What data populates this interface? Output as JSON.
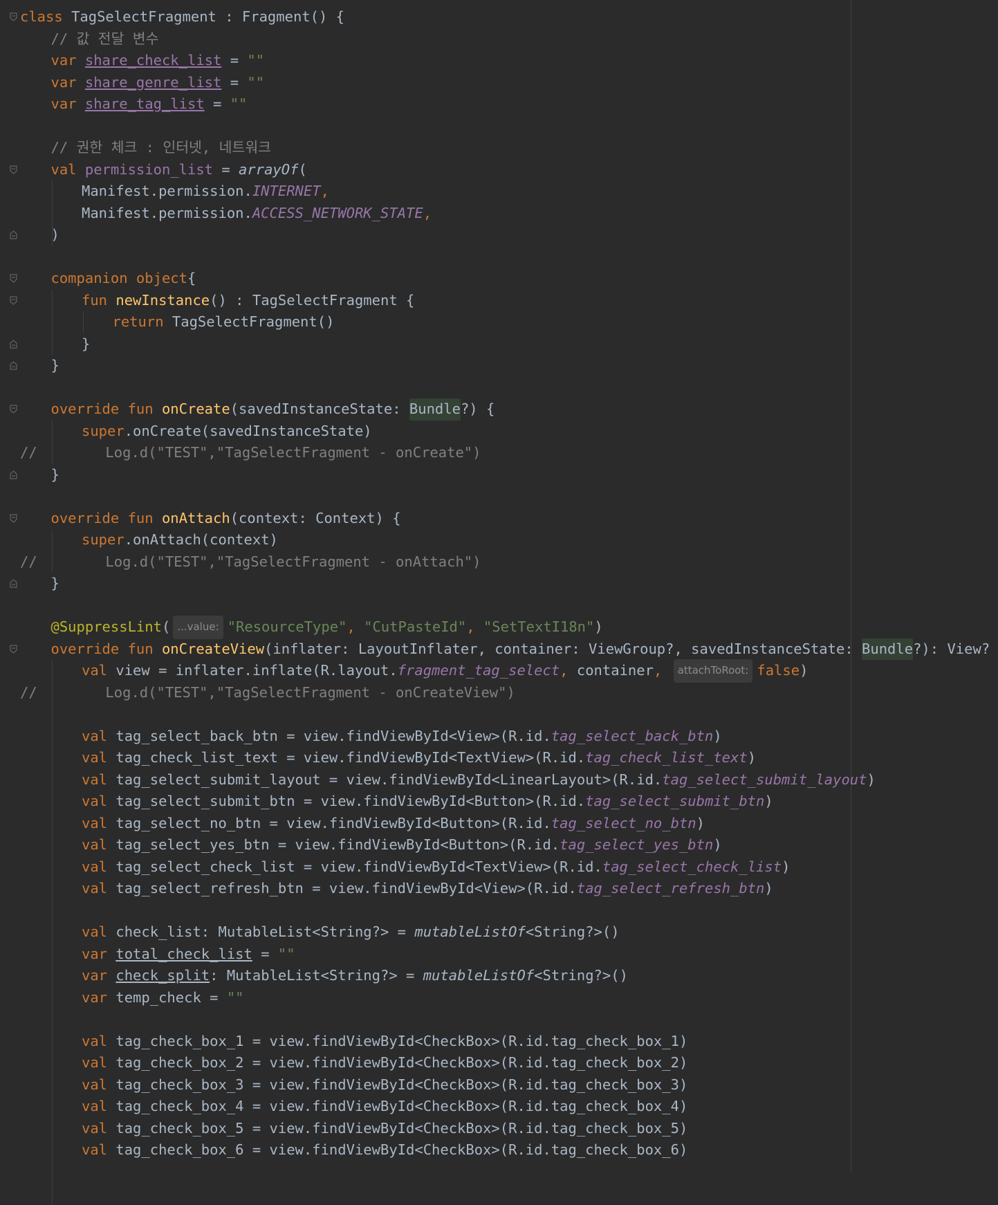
{
  "editor": {
    "language": "Kotlin",
    "theme_colors": {
      "background": "#2b2b2b",
      "keyword": "#cc7832",
      "comment": "#808080",
      "string": "#6a8759",
      "function": "#ffc66d",
      "property": "#9876aa",
      "default": "#a9b7c6",
      "annotation": "#bbb529"
    },
    "lines": [
      {
        "indent": 0,
        "fold": "open",
        "tokens": [
          [
            "kw",
            "class "
          ],
          [
            "",
            "TagSelectFragment : Fragment() {"
          ]
        ]
      },
      {
        "indent": 1,
        "tokens": [
          [
            "cm",
            "// 값 전달 변수"
          ]
        ]
      },
      {
        "indent": 1,
        "tokens": [
          [
            "kw",
            "var "
          ],
          [
            "prop ul",
            "share_check_list"
          ],
          [
            "",
            " = "
          ],
          [
            "str",
            "\"\""
          ]
        ]
      },
      {
        "indent": 1,
        "tokens": [
          [
            "kw",
            "var "
          ],
          [
            "prop ul",
            "share_genre_list"
          ],
          [
            "",
            " = "
          ],
          [
            "str",
            "\"\""
          ]
        ]
      },
      {
        "indent": 1,
        "tokens": [
          [
            "kw",
            "var "
          ],
          [
            "prop ul",
            "share_tag_list"
          ],
          [
            "",
            " = "
          ],
          [
            "str",
            "\"\""
          ]
        ]
      },
      {
        "indent": 0,
        "tokens": []
      },
      {
        "indent": 1,
        "tokens": [
          [
            "cm",
            "// 권한 체크 : 인터넷, 네트워크"
          ]
        ]
      },
      {
        "indent": 1,
        "fold": "open",
        "tokens": [
          [
            "kw",
            "val "
          ],
          [
            "prop",
            "permission_list"
          ],
          [
            "",
            " = "
          ],
          [
            "ital",
            "arrayOf"
          ],
          [
            "",
            "("
          ]
        ]
      },
      {
        "indent": 2,
        "tokens": [
          [
            "",
            "Manifest.permission."
          ],
          [
            "prop ital",
            "INTERNET"
          ],
          [
            "kw",
            ","
          ]
        ]
      },
      {
        "indent": 2,
        "tokens": [
          [
            "",
            "Manifest.permission."
          ],
          [
            "prop ital",
            "ACCESS_NETWORK_STATE"
          ],
          [
            "kw",
            ","
          ]
        ]
      },
      {
        "indent": 1,
        "fold": "close",
        "tokens": [
          [
            "",
            ")"
          ]
        ]
      },
      {
        "indent": 0,
        "tokens": []
      },
      {
        "indent": 1,
        "fold": "open",
        "tokens": [
          [
            "kw",
            "companion object"
          ],
          [
            "",
            "{"
          ]
        ]
      },
      {
        "indent": 2,
        "fold": "open",
        "tokens": [
          [
            "kw",
            "fun "
          ],
          [
            "fn",
            "newInstance"
          ],
          [
            "",
            "() : TagSelectFragment {"
          ]
        ]
      },
      {
        "indent": 3,
        "tokens": [
          [
            "kw",
            "return "
          ],
          [
            "",
            "TagSelectFragment()"
          ]
        ]
      },
      {
        "indent": 2,
        "fold": "close",
        "tokens": [
          [
            "",
            "}"
          ]
        ]
      },
      {
        "indent": 1,
        "fold": "close",
        "tokens": [
          [
            "",
            "}"
          ]
        ]
      },
      {
        "indent": 0,
        "tokens": []
      },
      {
        "indent": 1,
        "fold": "open",
        "tokens": [
          [
            "kw",
            "override fun "
          ],
          [
            "fn",
            "onCreate"
          ],
          [
            "",
            "(savedInstanceState: "
          ],
          [
            "hl",
            "Bundle"
          ],
          [
            "",
            "?) {"
          ]
        ]
      },
      {
        "indent": 2,
        "tokens": [
          [
            "kw",
            "super"
          ],
          [
            "",
            ".onCreate(savedInstanceState)"
          ]
        ]
      },
      {
        "indent": 0,
        "linecomment": true,
        "tokens": [
          [
            "cm",
            "//        Log.d(\"TEST\",\"TagSelectFragment - onCreate\")"
          ]
        ]
      },
      {
        "indent": 1,
        "fold": "close",
        "tokens": [
          [
            "",
            "}"
          ]
        ]
      },
      {
        "indent": 0,
        "tokens": []
      },
      {
        "indent": 1,
        "fold": "open",
        "tokens": [
          [
            "kw",
            "override fun "
          ],
          [
            "fn",
            "onAttach"
          ],
          [
            "",
            "(context: Context) {"
          ]
        ]
      },
      {
        "indent": 2,
        "tokens": [
          [
            "kw",
            "super"
          ],
          [
            "",
            ".onAttach(context)"
          ]
        ]
      },
      {
        "indent": 0,
        "linecomment": true,
        "tokens": [
          [
            "cm",
            "//        Log.d(\"TEST\",\"TagSelectFragment - onAttach\")"
          ]
        ]
      },
      {
        "indent": 1,
        "fold": "close",
        "tokens": [
          [
            "",
            "}"
          ]
        ]
      },
      {
        "indent": 0,
        "tokens": []
      },
      {
        "indent": 1,
        "tokens": [
          [
            "ann",
            "@SuppressLint"
          ],
          [
            "",
            "("
          ],
          [
            "hint",
            "...value:"
          ],
          [
            "str",
            "\"ResourceType\""
          ],
          [
            "kw",
            ", "
          ],
          [
            "str",
            "\"CutPasteId\""
          ],
          [
            "kw",
            ", "
          ],
          [
            "str",
            "\"SetTextI18n\""
          ],
          [
            "",
            ")"
          ]
        ]
      },
      {
        "indent": 1,
        "fold": "open",
        "tokens": [
          [
            "kw",
            "override fun "
          ],
          [
            "fn",
            "onCreateView"
          ],
          [
            "",
            "(inflater: LayoutInflater, container: ViewGroup?, savedInstanceState: "
          ],
          [
            "hl",
            "Bundle"
          ],
          [
            "",
            "?): View? {"
          ]
        ]
      },
      {
        "indent": 2,
        "tokens": [
          [
            "kw",
            "val "
          ],
          [
            "",
            "view = inflater.inflate(R.layout."
          ],
          [
            "prop ital",
            "fragment_tag_select"
          ],
          [
            "kw",
            ", "
          ],
          [
            "",
            "container"
          ],
          [
            "kw",
            ", "
          ],
          [
            "hint",
            "attachToRoot:"
          ],
          [
            "kw",
            "false"
          ],
          [
            "",
            ")"
          ]
        ]
      },
      {
        "indent": 0,
        "linecomment": true,
        "tokens": [
          [
            "cm",
            "//        Log.d(\"TEST\",\"TagSelectFragment - onCreateView\")"
          ]
        ]
      },
      {
        "indent": 0,
        "tokens": []
      },
      {
        "indent": 2,
        "tokens": [
          [
            "kw",
            "val "
          ],
          [
            "",
            "tag_select_back_btn = view.findViewById<View>(R.id."
          ],
          [
            "prop ital",
            "tag_select_back_btn"
          ],
          [
            "",
            ")"
          ]
        ]
      },
      {
        "indent": 2,
        "tokens": [
          [
            "kw",
            "val "
          ],
          [
            "",
            "tag_check_list_text = view.findViewById<TextView>(R.id."
          ],
          [
            "prop ital",
            "tag_check_list_text"
          ],
          [
            "",
            ")"
          ]
        ]
      },
      {
        "indent": 2,
        "tokens": [
          [
            "kw",
            "val "
          ],
          [
            "",
            "tag_select_submit_layout = view.findViewById<LinearLayout>(R.id."
          ],
          [
            "prop ital",
            "tag_select_submit_layout"
          ],
          [
            "",
            ")"
          ]
        ]
      },
      {
        "indent": 2,
        "tokens": [
          [
            "kw",
            "val "
          ],
          [
            "",
            "tag_select_submit_btn = view.findViewById<Button>(R.id."
          ],
          [
            "prop ital",
            "tag_select_submit_btn"
          ],
          [
            "",
            ")"
          ]
        ]
      },
      {
        "indent": 2,
        "tokens": [
          [
            "kw",
            "val "
          ],
          [
            "",
            "tag_select_no_btn = view.findViewById<Button>(R.id."
          ],
          [
            "prop ital",
            "tag_select_no_btn"
          ],
          [
            "",
            ")"
          ]
        ]
      },
      {
        "indent": 2,
        "tokens": [
          [
            "kw",
            "val "
          ],
          [
            "",
            "tag_select_yes_btn = view.findViewById<Button>(R.id."
          ],
          [
            "prop ital",
            "tag_select_yes_btn"
          ],
          [
            "",
            ")"
          ]
        ]
      },
      {
        "indent": 2,
        "tokens": [
          [
            "kw",
            "val "
          ],
          [
            "",
            "tag_select_check_list = view.findViewById<TextView>(R.id."
          ],
          [
            "prop ital",
            "tag_select_check_list"
          ],
          [
            "",
            ")"
          ]
        ]
      },
      {
        "indent": 2,
        "tokens": [
          [
            "kw",
            "val "
          ],
          [
            "",
            "tag_select_refresh_btn = view.findViewById<View>(R.id."
          ],
          [
            "prop ital",
            "tag_select_refresh_btn"
          ],
          [
            "",
            ")"
          ]
        ]
      },
      {
        "indent": 0,
        "tokens": []
      },
      {
        "indent": 2,
        "tokens": [
          [
            "kw",
            "val "
          ],
          [
            "",
            "check_list: MutableList<String?> = "
          ],
          [
            "ital",
            "mutableListOf"
          ],
          [
            "",
            "<String?>()"
          ]
        ]
      },
      {
        "indent": 2,
        "tokens": [
          [
            "kw",
            "var "
          ],
          [
            "ulw",
            "total_check_list"
          ],
          [
            "",
            " = "
          ],
          [
            "str",
            "\"\""
          ]
        ]
      },
      {
        "indent": 2,
        "tokens": [
          [
            "kw",
            "var "
          ],
          [
            "ulw",
            "check_split"
          ],
          [
            "",
            ": MutableList<String?> = "
          ],
          [
            "ital",
            "mutableListOf"
          ],
          [
            "",
            "<String?>()"
          ]
        ]
      },
      {
        "indent": 2,
        "tokens": [
          [
            "kw",
            "var "
          ],
          [
            "",
            "temp_check = "
          ],
          [
            "str",
            "\"\""
          ]
        ]
      },
      {
        "indent": 0,
        "tokens": []
      },
      {
        "indent": 2,
        "tokens": [
          [
            "kw",
            "val "
          ],
          [
            "",
            "tag_check_box_1 = view.findViewById<CheckBox>(R.id.tag_check_box_1)"
          ]
        ]
      },
      {
        "indent": 2,
        "tokens": [
          [
            "kw",
            "val "
          ],
          [
            "",
            "tag_check_box_2 = view.findViewById<CheckBox>(R.id.tag_check_box_2)"
          ]
        ]
      },
      {
        "indent": 2,
        "tokens": [
          [
            "kw",
            "val "
          ],
          [
            "",
            "tag_check_box_3 = view.findViewById<CheckBox>(R.id.tag_check_box_3)"
          ]
        ]
      },
      {
        "indent": 2,
        "tokens": [
          [
            "kw",
            "val "
          ],
          [
            "",
            "tag_check_box_4 = view.findViewById<CheckBox>(R.id.tag_check_box_4)"
          ]
        ]
      },
      {
        "indent": 2,
        "tokens": [
          [
            "kw",
            "val "
          ],
          [
            "",
            "tag_check_box_5 = view.findViewById<CheckBox>(R.id.tag_check_box_5)"
          ]
        ]
      },
      {
        "indent": 2,
        "tokens": [
          [
            "kw",
            "val "
          ],
          [
            "",
            "tag_check_box_6 = view.findViewById<CheckBox>(R.id.tag_check_box_6)"
          ]
        ]
      }
    ]
  }
}
